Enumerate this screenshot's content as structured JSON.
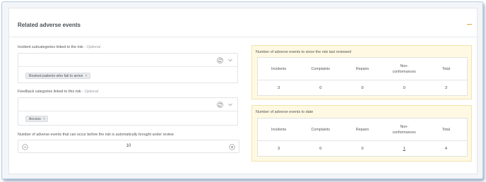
{
  "section": {
    "title": "Related adverse events",
    "collapse_icon": "minus-icon",
    "accent_color": "#e8a33c"
  },
  "incident_subcategories": {
    "label": "Incident subcategories linked to the risk",
    "optional_label": " - Optional",
    "chips": [
      "Booked patients who fail to arrive"
    ]
  },
  "feedback_categories": {
    "label": "Feedback categories linked to this risk",
    "optional_label": " - Optional",
    "chips": [
      "Access"
    ]
  },
  "threshold": {
    "label": "Number of adverse events that can occur before the risk is automatically brought under review",
    "value": "10"
  },
  "since_review": {
    "title": "Number of adverse events to since the risk last reviewed",
    "columns": [
      "Incidents",
      "Complaints",
      "Repairs",
      "Non-\nconformances",
      "Total"
    ],
    "values": [
      "3",
      "0",
      "0",
      "0",
      "3"
    ]
  },
  "to_date": {
    "title": "Number of adverse events to date",
    "columns": [
      "Incidents",
      "Complaints",
      "Repairs",
      "Non-\nconformances",
      "Total"
    ],
    "values": [
      "3",
      "0",
      "0",
      "1",
      "4"
    ]
  },
  "colors": {
    "panel_highlight": "#fff9e3",
    "frame_border": "#b9cfe6"
  }
}
